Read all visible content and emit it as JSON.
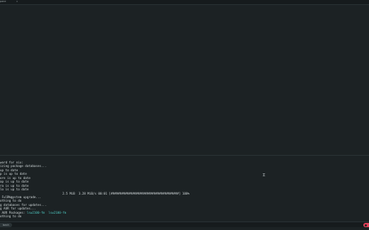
{
  "tab": {
    "title": "pane",
    "close": "x"
  },
  "terminal": {
    "lines": [
      "word for nix:",
      "izing package databases...",
      "up to date",
      "p is up to date",
      "ore is up to date",
      "ap is up to date",
      "ra is up to date",
      "lo is up to date",
      "Pkg",
      " Full system upgrade...",
      "othing to do",
      "g databases for updates...",
      "g AUR for updates...",
      " AUR Packages: ",
      "othing to do"
    ],
    "progress": "2.5 MiB  3.28 MiB/s 00:01 [######################################] 100%",
    "aur_packages": "lsw2100-fm  lsw2100-fm"
  },
  "statusbar": {
    "tab_label": "bash"
  }
}
